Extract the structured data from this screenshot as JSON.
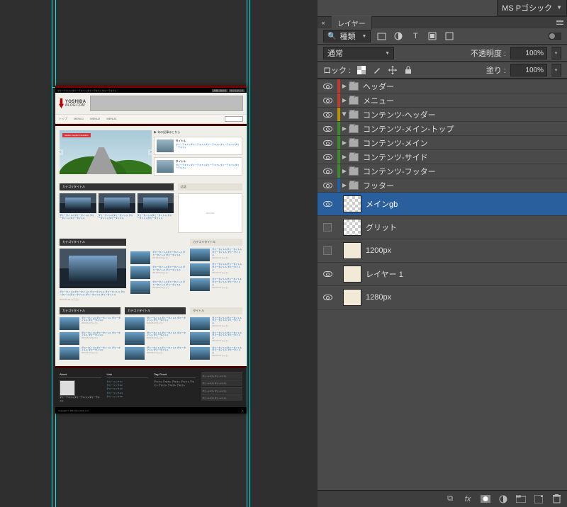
{
  "fontbar": {
    "name": "MS Pゴシック"
  },
  "panel": {
    "tab": "レイヤー",
    "filter": {
      "label": "種類"
    },
    "blend": {
      "mode": "通常",
      "opacity_label": "不透明度 :",
      "opacity": "100%"
    },
    "lock": {
      "label": "ロック :",
      "fill_label": "塗り :",
      "fill": "100%"
    },
    "groups": [
      {
        "name": "ヘッダー",
        "color": "s-red",
        "open": false
      },
      {
        "name": "メニュー",
        "color": "s-red",
        "open": false
      },
      {
        "name": "コンテンツ-ヘッダー",
        "color": "s-yellow",
        "open": true
      },
      {
        "name": "コンテンツ-メイン-トップ",
        "color": "s-green",
        "open": false
      },
      {
        "name": "コンテンツ-メイン",
        "color": "s-green",
        "open": false
      },
      {
        "name": "コンテンツ-サイド",
        "color": "s-green",
        "open": false
      },
      {
        "name": "コンテンツ-フッター",
        "color": "s-green",
        "open": false
      },
      {
        "name": "フッター",
        "color": "s-blue",
        "open": false
      }
    ],
    "layers": [
      {
        "name": "メインgb",
        "thumb": "chk-pattern",
        "selected": true,
        "vis": "eye"
      },
      {
        "name": "グリット",
        "thumb": "chk-pattern",
        "selected": false,
        "vis": "box"
      },
      {
        "name": "1200px",
        "thumb": "cream",
        "selected": false,
        "vis": "box"
      },
      {
        "name": "レイヤー 1",
        "thumb": "cream",
        "selected": false,
        "vis": "eye"
      },
      {
        "name": "1280px",
        "thumb": "cream",
        "selected": false,
        "vis": "eye"
      }
    ]
  },
  "doc": {
    "topbar_left": "ダミーテキストダミーテキストダミーテキストダミーテキスト",
    "topbar_links": [
      "お問い合わせ",
      "サイトマップ"
    ],
    "logo1": "YOSHIDA",
    "logo2": "BLOG.COM",
    "nav": [
      "トップ",
      "MENU1",
      "MENU2",
      "MENU3"
    ],
    "hero_caption": "random caption transition",
    "rec_head": "▶ 旬の記事はこちら",
    "rec": [
      {
        "t": "タイトル",
        "d": "ダミーテキストダミーテキストダミーテキストダミーテキストダミーテキスト"
      },
      {
        "t": "タイトル",
        "d": "ダミーテキストダミーテキストダミーテキストダミーテキストダミーテキスト"
      }
    ],
    "cat": "カテゴリタイトル",
    "ad": "広告",
    "adph": "300×250",
    "cardlink": "ダミータイトルダミータイトル ダミータイトルダミータイトル",
    "listtxt": "ダミータイトルダミータイトル ダミータイトル ダミータイトル",
    "meta": "2013-03-01  カテゴリ",
    "title_bar": "タイトル",
    "foot": {
      "about": "About",
      "link": "Link",
      "tag": "Tag Cloud",
      "links": [
        "ダミーリンク-01",
        "ダミーリンク-02",
        "ダミーリンク-03",
        "ダミーリンク-04",
        "ダミーリンク-05"
      ],
      "tags": "テキスト テキスト テキスト テキスト テキスト テキスト テキスト テキスト",
      "about_txt": "ダミーテキストダミーテキストダミーテキスト",
      "news": "ダミーテキストダミーテキスト"
    },
    "copy": "Copyright © 2013  bloomlink.com"
  }
}
